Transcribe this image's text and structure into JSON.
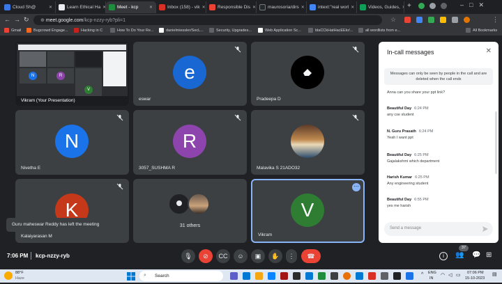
{
  "browser": {
    "tabs": [
      {
        "title": "Cloud Sh@",
        "color": "#3b78e7"
      },
      {
        "title": "Learn Ethical Ha",
        "color": "#e7eaef"
      },
      {
        "title": "Meet - kcp",
        "color": "#1e8e3e"
      },
      {
        "title": "Inbox (158) - vik",
        "color": "#d93025"
      },
      {
        "title": "Responsible Dis",
        "color": "#ea4335"
      },
      {
        "title": "maurosoria/dirs",
        "color": "#24292e"
      },
      {
        "title": "intext:\"real worl",
        "color": "#4285f4"
      },
      {
        "title": "Videos, Guides,",
        "color": "#0f9d58"
      }
    ],
    "url_host": "meet.google.com",
    "url_path": "/kcp-nzzy-ryb?pli=1",
    "bookmarks": [
      {
        "label": "Gmail",
        "color": "#ea4335"
      },
      {
        "label": "Bugcrowd Engage...",
        "color": "#f26822"
      },
      {
        "label": "Hacking in C",
        "color": "#c5221f"
      },
      {
        "label": "How To Do Your Re...",
        "color": "#5f6368"
      },
      {
        "label": "danielmiessler/SecL...",
        "color": "#ffffff"
      },
      {
        "label": "Security, Upgrades...",
        "color": "#5f6368"
      },
      {
        "label": "Web Application Sc...",
        "color": "#ffffff"
      },
      {
        "label": "blaCCkHatHacEEkr/...",
        "color": "#5f6368"
      },
      {
        "label": "all wordlists from e...",
        "color": "#5f6368"
      }
    ],
    "all_bookmarks": "All Bookmarks"
  },
  "meet": {
    "tiles": {
      "presentation": {
        "name": "Vikram (Your Presentation)"
      },
      "eswar": {
        "name": "eswar",
        "initial": "e",
        "color": "#1967d2"
      },
      "pradeepa": {
        "name": "Pradeepa D"
      },
      "nivetha": {
        "name": "Nivetha E",
        "initial": "N",
        "color": "#1a73e8"
      },
      "sushma": {
        "name": "3057_SUSHMA R",
        "initial": "R",
        "color": "#8e44ad"
      },
      "malavika": {
        "name": "Malavika S 21ADO32"
      },
      "kalaiyarasan": {
        "name": "Kalaiyarasan M",
        "initial": "K",
        "color": "#c5391a"
      },
      "others": {
        "name": "31 others"
      },
      "vikram": {
        "name": "Vikram",
        "initial": "V",
        "color": "#2e7d32"
      }
    },
    "toast": "Guru maheswar Reddy has left the meeting",
    "clock": "7:06 PM",
    "meeting_code": "kcp-nzzy-ryb",
    "people_count": "37"
  },
  "chat": {
    "title": "In-call messages",
    "notice": "Messages can only be seen by people in the call and are deleted when the call ends",
    "first_message": "Anna can you share your ppt link?",
    "messages": [
      {
        "sender": "Beautiful Day",
        "time": "6:24 PM",
        "text": "any cse student"
      },
      {
        "sender": "N. Guru Prasath",
        "time": "6:24 PM",
        "text": "Yeah I want ppt"
      },
      {
        "sender": "Beautiful Day",
        "time": "6:25 PM",
        "text": "Gajalakshmi which department"
      },
      {
        "sender": "Harish Kumar",
        "time": "6:25 PM",
        "text": "Any engineering student"
      },
      {
        "sender": "Beautiful Day",
        "time": "6:55 PM",
        "text": "yes me harish"
      }
    ],
    "input_placeholder": "Send a message"
  },
  "taskbar": {
    "weather_temp": "88°F",
    "weather_desc": "Haze",
    "search": "Search",
    "lang_top": "ENG",
    "lang_bottom": "IN",
    "time": "07:06 PM",
    "date": "15-10-2023"
  }
}
